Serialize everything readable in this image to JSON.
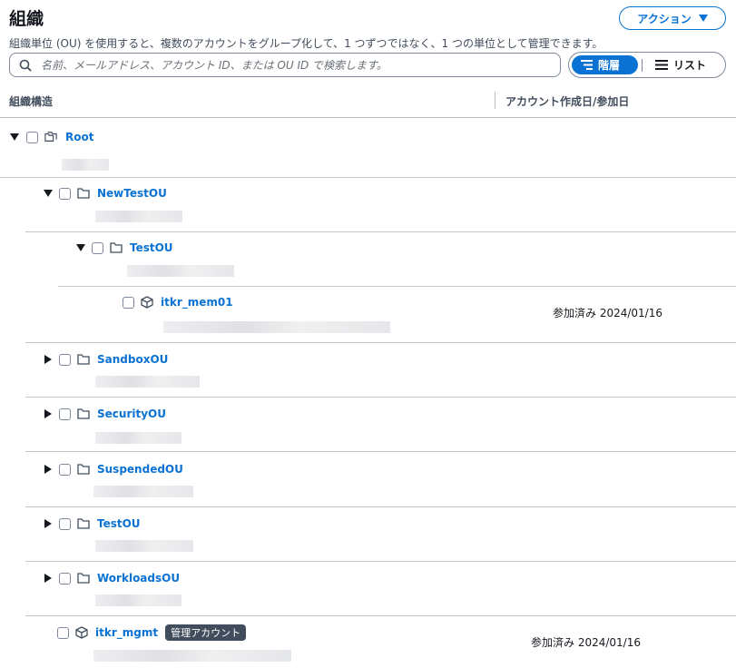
{
  "header": {
    "title": "組織",
    "description": "組織単位 (OU) を使用すると、複数のアカウントをグループ化して、1 つずつではなく、1 つの単位として管理できます。",
    "action_label": "アクション"
  },
  "search": {
    "placeholder": "名前、メールアドレス、アカウント ID、または OU ID で検索します。",
    "value": ""
  },
  "view_toggle": {
    "hierarchy_label": "階層",
    "list_label": "リスト",
    "selected": "階層"
  },
  "columns": {
    "structure": "組織構造",
    "date": "アカウント作成日/参加日"
  },
  "colors": {
    "accent": "#0972d3",
    "badge_bg": "#414d5c"
  },
  "tree": {
    "root": {
      "name": "Root",
      "expanded": true
    },
    "newtestou": {
      "name": "NewTestOU",
      "expanded": true
    },
    "testou_nested": {
      "name": "TestOU",
      "expanded": true
    },
    "itkr_mem01": {
      "name": "itkr_mem01",
      "date": "参加済み 2024/01/16"
    },
    "sandboxou": {
      "name": "SandboxOU",
      "expanded": false
    },
    "securityou": {
      "name": "SecurityOU",
      "expanded": false
    },
    "suspendedou": {
      "name": "SuspendedOU",
      "expanded": false
    },
    "testou": {
      "name": "TestOU",
      "expanded": false
    },
    "workloadsou": {
      "name": "WorkloadsOU",
      "expanded": false
    },
    "itkr_mgmt": {
      "name": "itkr_mgmt",
      "badge": "管理アカウント",
      "date": "参加済み 2024/01/16"
    }
  }
}
